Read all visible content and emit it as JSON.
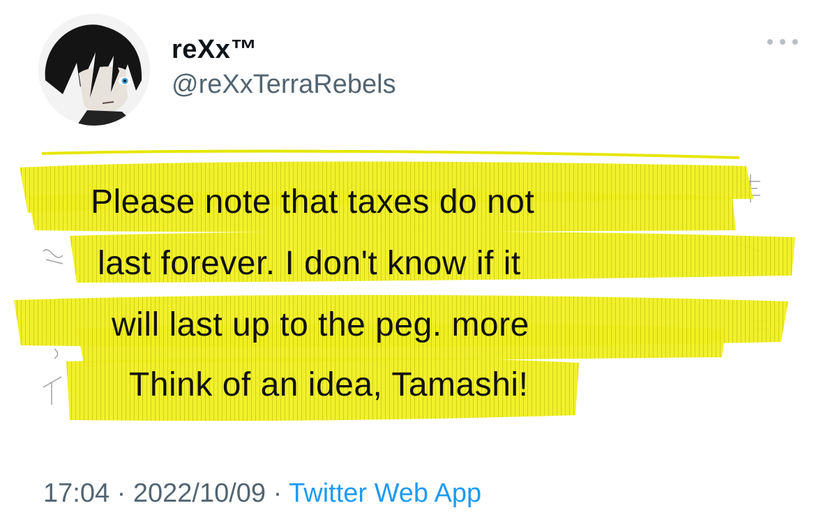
{
  "tweet": {
    "display_name": "reXx™",
    "handle": "@reXxTerraRebels",
    "body_lines": [
      "Please note that taxes do not",
      "last forever. I don't know if it",
      "will last up to the peg. more",
      "Think of an idea, Tamashi!"
    ],
    "time": "17:04",
    "separator": "·",
    "date": "2022/10/09",
    "source": "Twitter Web App"
  },
  "icons": {
    "more": "more-horizontal-icon",
    "avatar": "avatar-anime-character"
  },
  "colors": {
    "highlight": "#f0f020",
    "name": "#0f1419",
    "secondary": "#536471",
    "link": "#1d9bf0",
    "more_dots": "#b8bfc6"
  }
}
